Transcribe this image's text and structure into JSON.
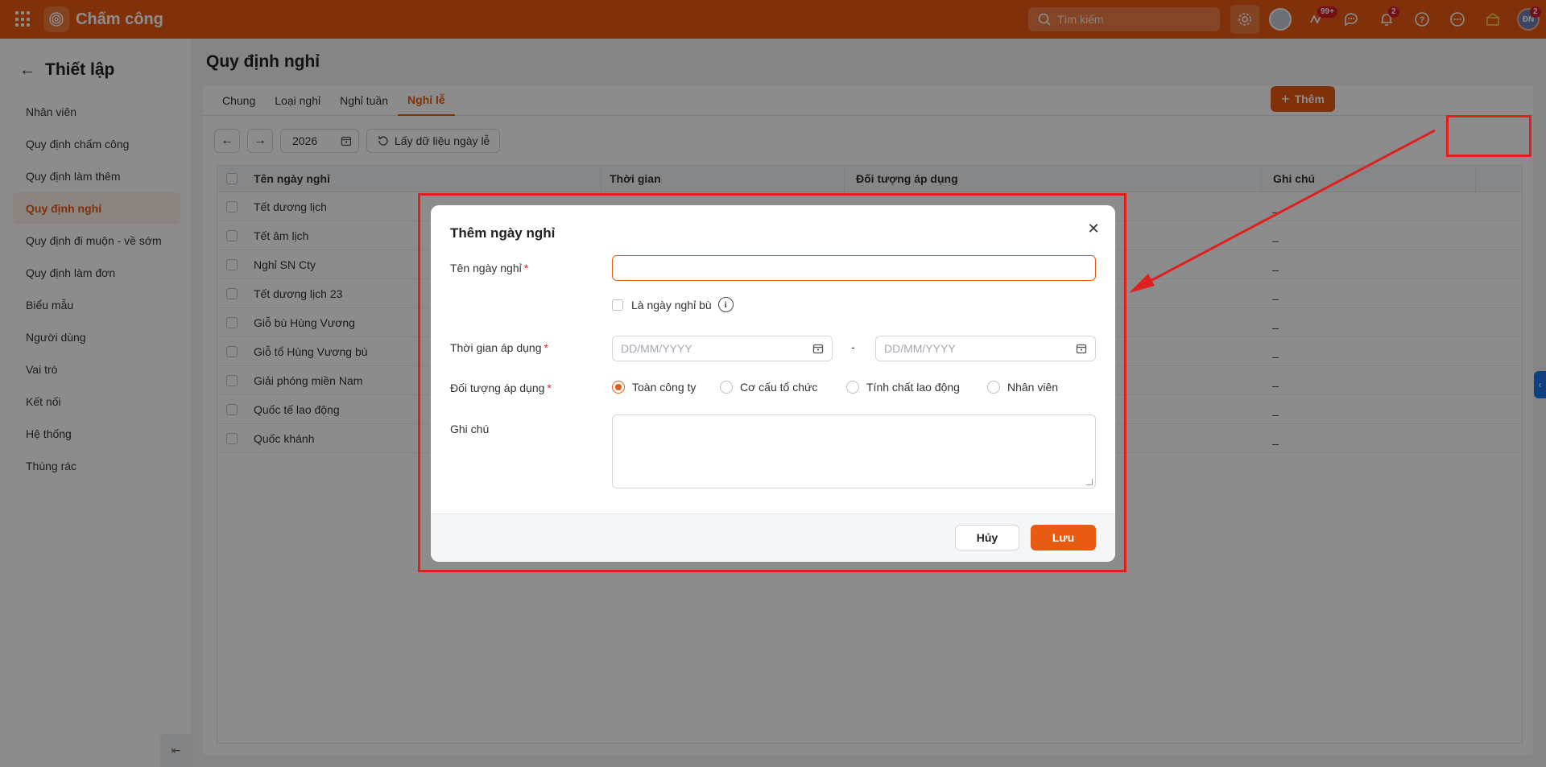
{
  "app": {
    "title": "Chấm công",
    "search_placeholder": "Tìm kiếm",
    "badge_apps": "99+",
    "badge_bell": "2",
    "badge_avatar": "2",
    "avatar_initials": "ĐN"
  },
  "sidebar": {
    "title": "Thiết lập",
    "items": [
      {
        "label": "Nhân viên"
      },
      {
        "label": "Quy định chấm công"
      },
      {
        "label": "Quy định làm thêm"
      },
      {
        "label": "Quy định nghỉ"
      },
      {
        "label": "Quy định đi muộn - về sớm"
      },
      {
        "label": "Quy định làm đơn"
      },
      {
        "label": "Biểu mẫu"
      },
      {
        "label": "Người dùng"
      },
      {
        "label": "Vai trò"
      },
      {
        "label": "Kết nối"
      },
      {
        "label": "Hệ thống"
      },
      {
        "label": "Thùng rác"
      }
    ],
    "active_index": 3
  },
  "page": {
    "title": "Quy định nghỉ",
    "tabs": [
      {
        "label": "Chung"
      },
      {
        "label": "Loại nghỉ"
      },
      {
        "label": "Nghỉ tuần"
      },
      {
        "label": "Nghỉ lễ"
      }
    ],
    "active_tab": 3,
    "year": "2026",
    "fetch_label": "Lấy dữ liệu ngày lễ",
    "add_label": "Thêm"
  },
  "table": {
    "headers": {
      "name": "Tên ngày nghỉ",
      "time": "Thời gian",
      "target": "Đối tượng áp dụng",
      "note": "Ghi chú"
    },
    "rows": [
      {
        "name": "Tết dương lịch",
        "note": "_"
      },
      {
        "name": "Tết âm lịch",
        "note": "_"
      },
      {
        "name": "Nghỉ SN Cty",
        "note": "_"
      },
      {
        "name": "Tết dương lịch 23",
        "note": "_"
      },
      {
        "name": "Giỗ bù Hùng Vương",
        "note": "_"
      },
      {
        "name": "Giỗ tổ Hùng Vương bù",
        "note": "_"
      },
      {
        "name": "Giải phóng miền Nam",
        "note": "_"
      },
      {
        "name": "Quốc tế lao động",
        "note": "_"
      },
      {
        "name": "Quốc khánh",
        "note": "_"
      }
    ]
  },
  "modal": {
    "title": "Thêm ngày nghỉ",
    "name_label": "Tên ngày nghỉ",
    "name_value": "",
    "compensatory_label": "Là ngày nghỉ bù",
    "time_label": "Thời gian áp dụng",
    "date_placeholder": "DD/MM/YYYY",
    "date_separator": "-",
    "target_label": "Đối tượng áp dụng",
    "target_options": [
      {
        "label": "Toàn công ty",
        "checked": true
      },
      {
        "label": "Cơ cấu tổ chức",
        "checked": false
      },
      {
        "label": "Tính chất lao động",
        "checked": false
      },
      {
        "label": "Nhân viên",
        "checked": false
      }
    ],
    "note_label": "Ghi chú",
    "required_mark": "*",
    "cancel_label": "Hủy",
    "save_label": "Lưu"
  },
  "colors": {
    "brand": "#e95a12",
    "annotation": "#e01f1f"
  }
}
